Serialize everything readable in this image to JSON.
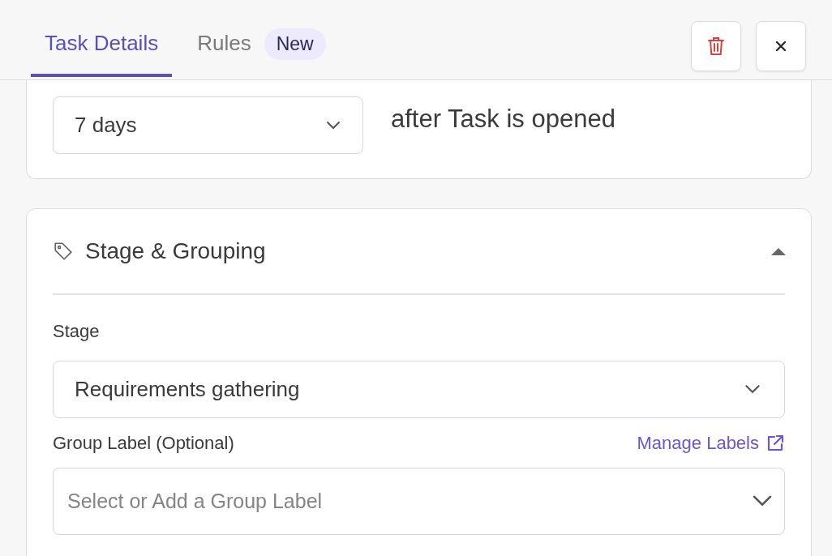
{
  "tabs": [
    {
      "label": "Task Details",
      "selected": true
    },
    {
      "label": "Rules",
      "selected": false,
      "badge": "New"
    }
  ],
  "duration": {
    "value": "7 days",
    "suffix": "after Task is opened"
  },
  "section": {
    "title": "Stage & Grouping",
    "expanded": true,
    "stage": {
      "label": "Stage",
      "value": "Requirements gathering"
    },
    "group_label": {
      "label": "Group Label (Optional)",
      "link": "Manage Labels",
      "placeholder": "Select or Add a Group Label"
    }
  }
}
